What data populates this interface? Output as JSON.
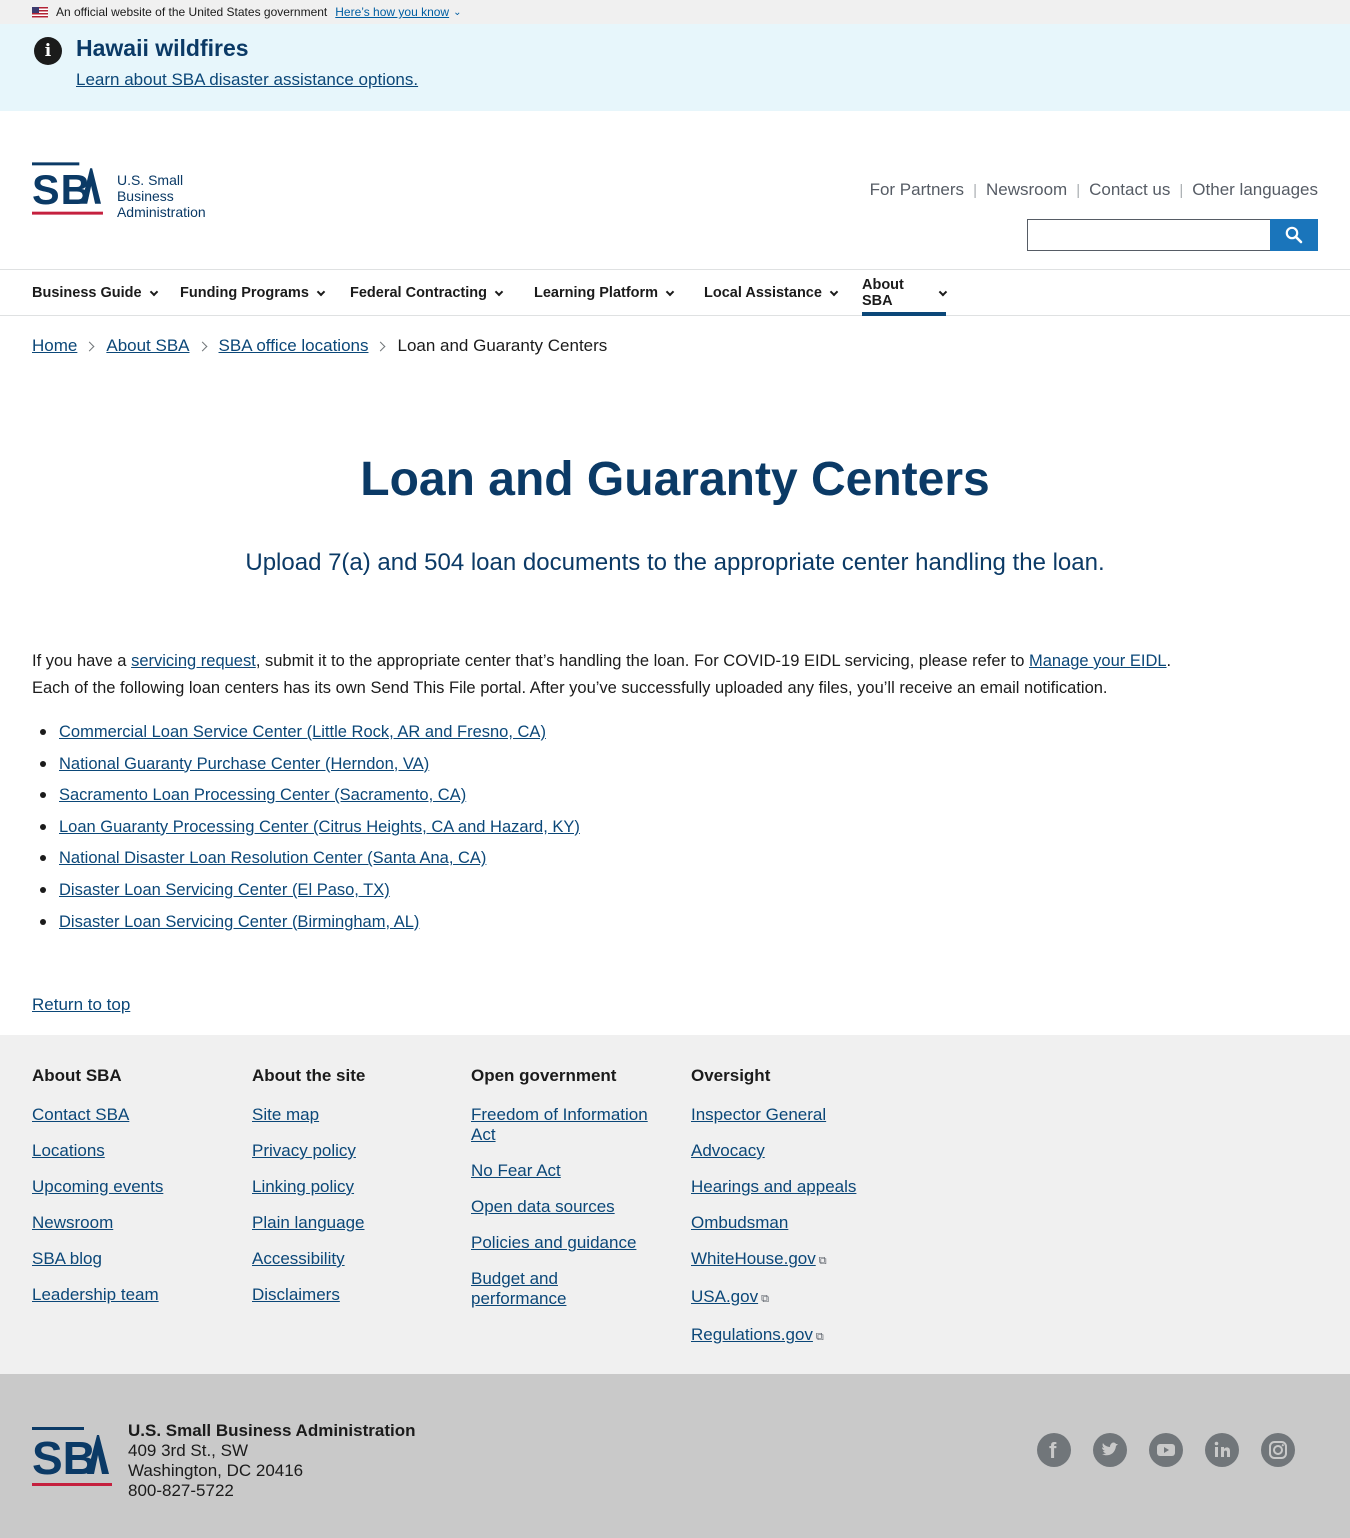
{
  "gov_banner": {
    "text": "An official website of the United States government",
    "link": "Here’s how you know"
  },
  "alert": {
    "title": "Hawaii wildfires",
    "link": "Learn about SBA disaster assistance options."
  },
  "header": {
    "logo_text_line1": "U.S. Small Business",
    "logo_text_line2": "Administration",
    "logo_letters": "SBA",
    "utility_links": [
      "For Partners",
      "Newsroom",
      "Contact us",
      "Other languages"
    ],
    "search_placeholder": ""
  },
  "nav": {
    "items": [
      {
        "label": "Business Guide"
      },
      {
        "label": "Funding Programs"
      },
      {
        "label": "Federal Contracting"
      },
      {
        "label": "Learning Platform"
      },
      {
        "label": "Local Assistance"
      },
      {
        "label": "About SBA",
        "active": true
      }
    ]
  },
  "breadcrumb": {
    "items": [
      "Home",
      "About SBA",
      "SBA office locations"
    ],
    "current": "Loan and Guaranty Centers"
  },
  "page": {
    "title": "Loan and Guaranty Centers",
    "subtitle": "Upload 7(a) and 504 loan documents to the appropriate center handling the loan.",
    "para_1": "If you have a ",
    "para_link_1": "servicing request",
    "para_2": ", submit it to the appropriate center that’s handling the loan. For COVID-19 EIDL servicing, please refer to ",
    "para_link_2": "Manage your EIDL",
    "para_3": ". Each of the following loan centers has its own Send This File portal. After you’ve successfully uploaded any files, you’ll receive an email notification.",
    "centers": [
      "Commercial Loan Service Center (Little Rock, AR and Fresno, CA)",
      "National Guaranty Purchase Center (Herndon, VA)",
      "Sacramento Loan Processing Center (Sacramento, CA)",
      "Loan Guaranty Processing Center (Citrus Heights, CA and Hazard, KY)",
      "National Disaster Loan Resolution Center (Santa Ana, CA)",
      "Disaster Loan Servicing Center (El Paso, TX)",
      "Disaster Loan Servicing Center (Birmingham, AL)"
    ],
    "return_top": "Return to top"
  },
  "footer": {
    "columns": [
      {
        "heading": "About SBA",
        "links": [
          "Contact SBA",
          "Locations",
          "Upcoming events",
          "Newsroom",
          "SBA blog",
          "Leadership team"
        ]
      },
      {
        "heading": "About the site",
        "links": [
          "Site map",
          "Privacy policy",
          "Linking policy",
          "Plain language",
          "Accessibility",
          "Disclaimers"
        ]
      },
      {
        "heading": "Open government",
        "links": [
          "Freedom of Information Act",
          "No Fear Act",
          "Open data sources",
          "Policies and guidance",
          "Budget and performance"
        ]
      },
      {
        "heading": "Oversight",
        "links": [
          "Inspector General",
          "Advocacy",
          "Hearings and appeals",
          "Ombudsman",
          "WhiteHouse.gov",
          "USA.gov",
          "Regulations.gov"
        ]
      }
    ],
    "external_links": [
      "WhiteHouse.gov",
      "USA.gov",
      "Regulations.gov"
    ],
    "org": "U.S. Small Business Administration",
    "address1": "409 3rd St., SW",
    "address2": "Washington, DC 20416",
    "phone": "800-827-5722",
    "social_icons": [
      "facebook-icon",
      "twitter-icon",
      "youtube-icon",
      "linkedin-icon",
      "instagram-icon"
    ]
  },
  "colors": {
    "brand_navy": "#0b3a66",
    "link": "#0b4778",
    "brand_red": "#c5203e",
    "search_button": "#1a75bb",
    "alert_bg": "#e7f6fb"
  }
}
